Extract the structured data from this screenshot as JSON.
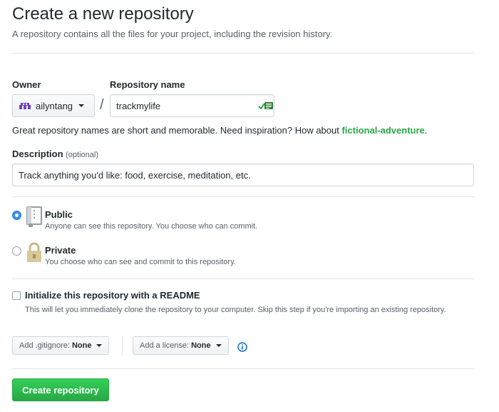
{
  "header": {
    "title": "Create a new repository",
    "subtitle": "A repository contains all the files for your project, including the revision history."
  },
  "owner": {
    "label": "Owner",
    "name": "ailyntang"
  },
  "repo": {
    "label": "Repository name",
    "separator": "/",
    "value": "trackmylife"
  },
  "hint": {
    "text": "Great repository names are short and memorable. Need inspiration? How about ",
    "suggestion": "fictional-adventure",
    "end": "."
  },
  "description": {
    "label": "Description",
    "optional": "(optional)",
    "value": "Track anything you'd like: food, exercise, meditation, etc."
  },
  "visibility": {
    "public": {
      "title": "Public",
      "note": "Anyone can see this repository. You choose who can commit.",
      "selected": true
    },
    "private": {
      "title": "Private",
      "note": "You choose who can see and commit to this repository.",
      "selected": false
    }
  },
  "readme": {
    "title": "Initialize this repository with a README",
    "note": "This will let you immediately clone the repository to your computer. Skip this step if you're importing an existing repository.",
    "checked": false
  },
  "gitignore": {
    "label": "Add .gitignore:",
    "value": "None"
  },
  "license": {
    "label": "Add a license:",
    "value": "None"
  },
  "submit": {
    "label": "Create repository"
  },
  "colors": {
    "primary_green": "#28a745",
    "radio_blue": "#3b8ef0",
    "info_blue": "#0366d6",
    "owner_avatar": "#6f42c1"
  },
  "icons": {
    "public": "repo-book-icon",
    "private": "lock-icon",
    "valid": "check-icon",
    "info": "info-icon"
  }
}
